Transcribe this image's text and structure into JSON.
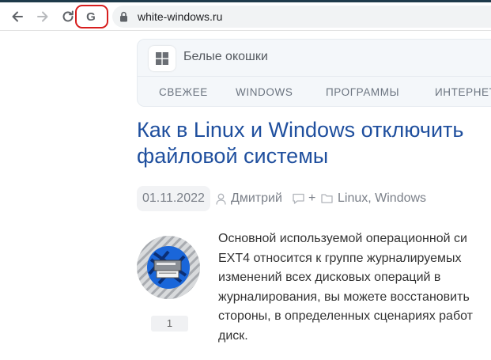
{
  "browser": {
    "url": "white-windows.ru",
    "extension_letter": "G"
  },
  "site": {
    "name": "Белые окошки",
    "nav": [
      "СВЕЖЕЕ",
      "WINDOWS",
      "ПРОГРАММЫ",
      "ИНТЕРНЕТ"
    ]
  },
  "article": {
    "title_line1": "Как в Linux и Windows отключить",
    "title_line2": "файловой системы",
    "date": "01.11.2022",
    "author": "Дмитрий",
    "comments": "+",
    "categories": "Linux, Windows",
    "avatar_count": "1",
    "body": [
      "Основной используемой операционной си",
      "EXT4 относится к группе журналируемых",
      "изменений всех дисковых операций в",
      "журналирования, вы можете восстановить",
      "стороны, в определенных сценариях работ",
      "диск."
    ]
  },
  "colors": {
    "title": "#1f4f9e",
    "highlight": "#d71e1e",
    "top_strip": "#1e3a4a"
  }
}
